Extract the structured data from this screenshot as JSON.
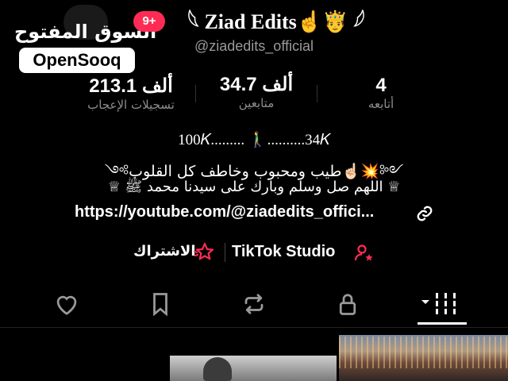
{
  "watermark": {
    "arabic": "السوق المفتوح",
    "brand": "OpenSooq"
  },
  "header": {
    "notification_badge": "9+",
    "title": "𓆩 Ziad Edits☝️🤴 𓆪",
    "handle": "@ziadedits_official"
  },
  "stats": [
    {
      "value": "4",
      "label": "أتابعه"
    },
    {
      "value": "34.7 ألف",
      "label": "متابعين"
    },
    {
      "value": "213.1 ألف",
      "label": "تسجيلات الإعجاب"
    }
  ],
  "bio": {
    "line1": "100𝐾......... 🚶‍♂️..........34𝐾",
    "line2": "༺طيب ومحبوب وخاطف كل القلوب☝🏻💥༻",
    "line3": "♕ اللهم صل وسلم وبارك على سيدنا محمد ﷺ ♕",
    "link": "https://youtube.com/@ziadedits_offici..."
  },
  "actions": {
    "studio": "TikTok Studio",
    "subscribe": "الاشتراك"
  },
  "tabs": [
    "liked-heart",
    "saved-bookmark",
    "reposts",
    "private-lock",
    "videos-grid"
  ],
  "colors": {
    "accent": "#fe2c55",
    "muted": "#8e8e8e"
  }
}
